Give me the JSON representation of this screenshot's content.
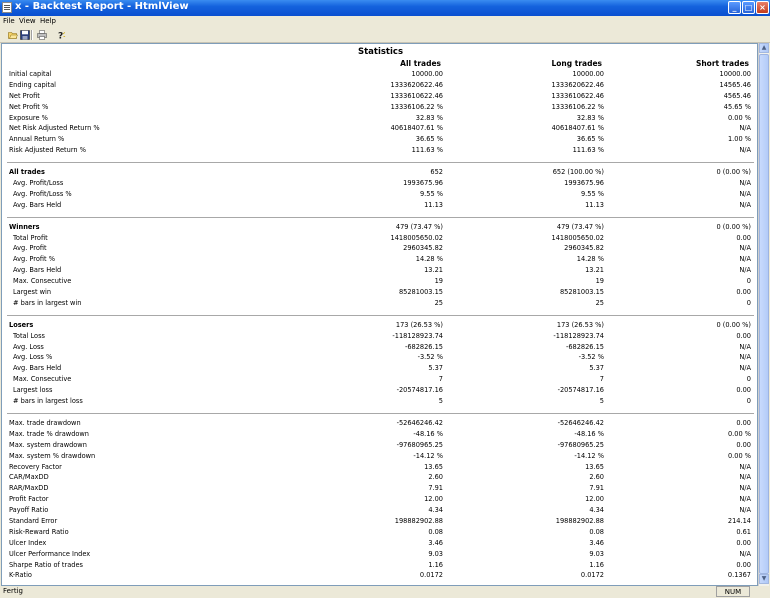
{
  "window": {
    "title": "x - Backtest Report - HtmlView"
  },
  "menu": [
    "File",
    "View",
    "Help"
  ],
  "toolbar": {
    "icons": [
      "open-folder-icon",
      "save-icon",
      "print-icon",
      "help-icon"
    ]
  },
  "report": {
    "title": "Statistics",
    "columns": [
      "All trades",
      "Long trades",
      "Short trades"
    ],
    "sections": [
      {
        "rows": [
          {
            "label": "Initial capital",
            "values": [
              "10000.00",
              "10000.00",
              "10000.00"
            ]
          },
          {
            "label": "Ending capital",
            "values": [
              "1333620622.46",
              "1333620622.46",
              "14565.46"
            ]
          },
          {
            "label": "Net Profit",
            "values": [
              "1333610622.46",
              "1333610622.46",
              "4565.46"
            ]
          },
          {
            "label": "Net Profit %",
            "values": [
              "13336106.22 %",
              "13336106.22 %",
              "45.65 %"
            ]
          },
          {
            "label": "Exposure %",
            "values": [
              "32.83 %",
              "32.83 %",
              "0.00 %"
            ]
          },
          {
            "label": "Net Risk Adjusted Return %",
            "values": [
              "40618407.61 %",
              "40618407.61 %",
              "N/A"
            ]
          },
          {
            "label": "Annual Return %",
            "values": [
              "36.65 %",
              "36.65 %",
              "1.00 %"
            ]
          },
          {
            "label": "Risk Adjusted Return %",
            "values": [
              "111.63 %",
              "111.63 %",
              "N/A"
            ]
          }
        ]
      },
      {
        "header": {
          "label": "All trades",
          "values": [
            "652",
            "652 (100.00 %)",
            "0 (0.00 %)"
          ]
        },
        "rows": [
          {
            "label": "Avg. Profit/Loss",
            "values": [
              "1993675.96",
              "1993675.96",
              "N/A"
            ]
          },
          {
            "label": "Avg. Profit/Loss %",
            "values": [
              "9.55 %",
              "9.55 %",
              "N/A"
            ]
          },
          {
            "label": "Avg. Bars Held",
            "values": [
              "11.13",
              "11.13",
              "N/A"
            ]
          }
        ]
      },
      {
        "header": {
          "label": "Winners",
          "values": [
            "479 (73.47 %)",
            "479 (73.47 %)",
            "0 (0.00 %)"
          ]
        },
        "rows": [
          {
            "label": "Total Profit",
            "values": [
              "1418005650.02",
              "1418005650.02",
              "0.00"
            ]
          },
          {
            "label": "Avg. Profit",
            "values": [
              "2960345.82",
              "2960345.82",
              "N/A"
            ]
          },
          {
            "label": "Avg. Profit %",
            "values": [
              "14.28 %",
              "14.28 %",
              "N/A"
            ]
          },
          {
            "label": "Avg. Bars Held",
            "values": [
              "13.21",
              "13.21",
              "N/A"
            ]
          },
          {
            "label": "Max. Consecutive",
            "values": [
              "19",
              "19",
              "0"
            ]
          },
          {
            "label": "Largest win",
            "values": [
              "85281003.15",
              "85281003.15",
              "0.00"
            ]
          },
          {
            "label": "# bars in largest win",
            "values": [
              "25",
              "25",
              "0"
            ]
          }
        ]
      },
      {
        "header": {
          "label": "Losers",
          "values": [
            "173 (26.53 %)",
            "173 (26.53 %)",
            "0 (0.00 %)"
          ]
        },
        "rows": [
          {
            "label": "Total Loss",
            "values": [
              "-118128923.74",
              "-118128923.74",
              "0.00"
            ]
          },
          {
            "label": "Avg. Loss",
            "values": [
              "-682826.15",
              "-682826.15",
              "N/A"
            ]
          },
          {
            "label": "Avg. Loss %",
            "values": [
              "-3.52 %",
              "-3.52 %",
              "N/A"
            ]
          },
          {
            "label": "Avg. Bars Held",
            "values": [
              "5.37",
              "5.37",
              "N/A"
            ]
          },
          {
            "label": "Max. Consecutive",
            "values": [
              "7",
              "7",
              "0"
            ]
          },
          {
            "label": "Largest loss",
            "values": [
              "-20574817.16",
              "-20574817.16",
              "0.00"
            ]
          },
          {
            "label": "# bars in largest loss",
            "values": [
              "5",
              "5",
              "0"
            ]
          }
        ]
      },
      {
        "rows": [
          {
            "label": "Max. trade drawdown",
            "values": [
              "-52646246.42",
              "-52646246.42",
              "0.00"
            ]
          },
          {
            "label": "Max. trade % drawdown",
            "values": [
              "-48.16 %",
              "-48.16 %",
              "0.00 %"
            ]
          },
          {
            "label": "Max. system drawdown",
            "values": [
              "-97680965.25",
              "-97680965.25",
              "0.00"
            ]
          },
          {
            "label": "Max. system % drawdown",
            "values": [
              "-14.12 %",
              "-14.12 %",
              "0.00 %"
            ]
          },
          {
            "label": "Recovery Factor",
            "values": [
              "13.65",
              "13.65",
              "N/A"
            ]
          },
          {
            "label": "CAR/MaxDD",
            "values": [
              "2.60",
              "2.60",
              "N/A"
            ]
          },
          {
            "label": "RAR/MaxDD",
            "values": [
              "7.91",
              "7.91",
              "N/A"
            ]
          },
          {
            "label": "Profit Factor",
            "values": [
              "12.00",
              "12.00",
              "N/A"
            ]
          },
          {
            "label": "Payoff Ratio",
            "values": [
              "4.34",
              "4.34",
              "N/A"
            ]
          },
          {
            "label": "Standard Error",
            "values": [
              "198882902.88",
              "198882902.88",
              "214.14"
            ]
          },
          {
            "label": "Risk-Reward Ratio",
            "values": [
              "0.08",
              "0.08",
              "0.61"
            ]
          },
          {
            "label": "Ulcer Index",
            "values": [
              "3.46",
              "3.46",
              "0.00"
            ]
          },
          {
            "label": "Ulcer Performance Index",
            "values": [
              "9.03",
              "9.03",
              "N/A"
            ]
          },
          {
            "label": "Sharpe Ratio of trades",
            "values": [
              "1.16",
              "1.16",
              "0.00"
            ]
          },
          {
            "label": "K-Ratio",
            "values": [
              "0.0172",
              "0.0172",
              "0.1367"
            ]
          }
        ]
      }
    ]
  },
  "status": {
    "text": "Fertig",
    "indicator": "NUM"
  }
}
